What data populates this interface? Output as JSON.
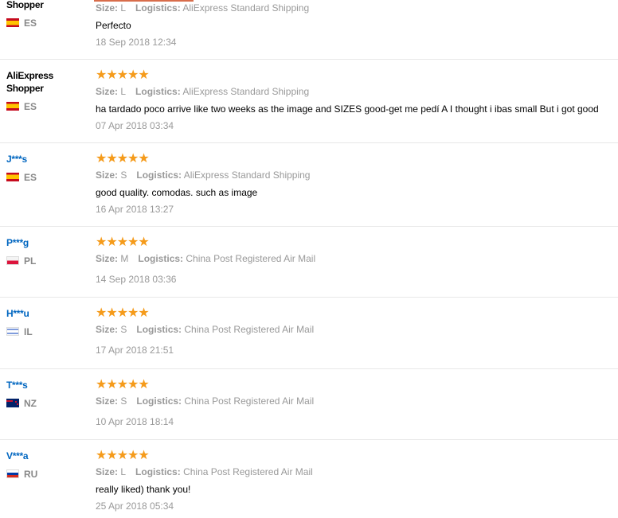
{
  "labels": {
    "size": "Size:",
    "logistics": "Logistics:"
  },
  "reviews": [
    {
      "name": "Shopper",
      "country": "ES",
      "flag": "es",
      "size": "L",
      "logistics": "AliExpress Standard Shipping",
      "text": "Perfecto",
      "date": "18 Sep 2018 12:34",
      "stars": "★★★★★"
    },
    {
      "name_line1": "AliExpress",
      "name_line2": "Shopper",
      "country": "ES",
      "flag": "es",
      "size": "L",
      "logistics": "AliExpress Standard Shipping",
      "text": "ha tardado poco arrive like two weeks as the image and SIZES good-get me pedí A I thought i ibas small But i got good",
      "date": "07 Apr 2018 03:34",
      "stars": "★★★★★"
    },
    {
      "name": "J***s",
      "country": "ES",
      "flag": "es",
      "size": "S",
      "logistics": "AliExpress Standard Shipping",
      "text": "good quality. comodas. such as image",
      "date": "16 Apr 2018 13:27",
      "stars": "★★★★★"
    },
    {
      "name": "P***g",
      "country": "PL",
      "flag": "pl",
      "size": "M",
      "logistics": "China Post Registered Air Mail",
      "text": "",
      "date": "14 Sep 2018 03:36",
      "stars": "★★★★★"
    },
    {
      "name": "H***u",
      "country": "IL",
      "flag": "il",
      "size": "S",
      "logistics": "China Post Registered Air Mail",
      "text": "",
      "date": "17 Apr 2018 21:51",
      "stars": "★★★★★"
    },
    {
      "name": "T***s",
      "country": "NZ",
      "flag": "nz",
      "size": "S",
      "logistics": "China Post Registered Air Mail",
      "text": "",
      "date": "10 Apr 2018 18:14",
      "stars": "★★★★★"
    },
    {
      "name": "V***a",
      "country": "RU",
      "flag": "ru",
      "size": "L",
      "logistics": "China Post Registered Air Mail",
      "text": "really liked) thank you!",
      "date": "25 Apr 2018 05:34",
      "stars": "★★★★★"
    }
  ],
  "colors": {
    "star": "#f59b1b",
    "link": "#0066c0",
    "muted": "#999999",
    "accent": "#d86d4b"
  }
}
